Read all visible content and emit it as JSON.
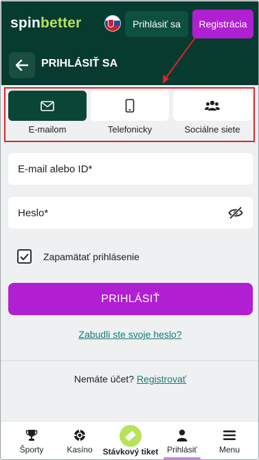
{
  "header": {
    "logo_spin": "spin",
    "logo_better": "better",
    "flag": "slovakia-flag",
    "login_label": "Prihlásiť sa",
    "register_label": "Registrácia"
  },
  "page": {
    "title": "PRIHLÁSIŤ SA"
  },
  "methods": [
    {
      "label": "E-mailom",
      "icon": "envelope-icon",
      "active": true
    },
    {
      "label": "Telefonicky",
      "icon": "phone-icon",
      "active": false
    },
    {
      "label": "Sociálne siete",
      "icon": "users-icon",
      "active": false
    }
  ],
  "form": {
    "email_placeholder": "E-mail alebo ID*",
    "email_value": "",
    "password_placeholder": "Heslo*",
    "password_value": "",
    "remember_label": "Zapamätať prihlásenie",
    "remember_checked": true,
    "submit_label": "PRIHLÁSIŤ",
    "forgot_label": "Zabudli ste svoje heslo?",
    "no_account_text": "Nemáte účet?",
    "register_link": "Registrovať"
  },
  "bottom_nav": [
    {
      "label": "Športy",
      "icon": "trophy-icon"
    },
    {
      "label": "Kasíno",
      "icon": "casino-chip-icon"
    },
    {
      "label": "Stávkový tiket",
      "icon": "ticket-icon"
    },
    {
      "label": "Prihlásiť",
      "icon": "user-icon",
      "active": true
    },
    {
      "label": "Menu",
      "icon": "menu-icon"
    }
  ],
  "colors": {
    "brand_dark": "#073b2f",
    "accent_purple": "#b01fd1",
    "accent_green": "#b6e35b",
    "link_teal": "#147d74",
    "highlight_red": "#e0232a"
  }
}
